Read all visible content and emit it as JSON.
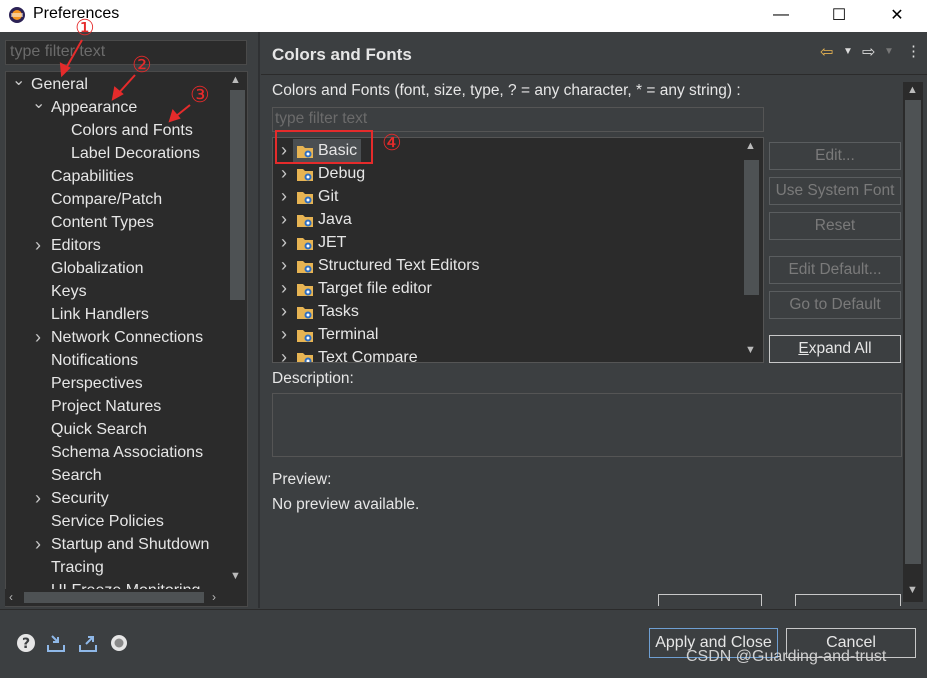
{
  "window": {
    "title": "Preferences",
    "controls": {
      "minimize": "—",
      "maximize": "☐",
      "close": "✕"
    }
  },
  "left": {
    "filter_placeholder": "type filter text",
    "tree": [
      {
        "label": "General",
        "level": 0,
        "expander": "down"
      },
      {
        "label": "Appearance",
        "level": 1,
        "expander": "down"
      },
      {
        "label": "Colors and Fonts",
        "level": 2,
        "expander": "none"
      },
      {
        "label": "Label Decorations",
        "level": 2,
        "expander": "none"
      },
      {
        "label": "Capabilities",
        "level": 1,
        "expander": "none"
      },
      {
        "label": "Compare/Patch",
        "level": 1,
        "expander": "none"
      },
      {
        "label": "Content Types",
        "level": 1,
        "expander": "none"
      },
      {
        "label": "Editors",
        "level": 1,
        "expander": "right"
      },
      {
        "label": "Globalization",
        "level": 1,
        "expander": "none"
      },
      {
        "label": "Keys",
        "level": 1,
        "expander": "none"
      },
      {
        "label": "Link Handlers",
        "level": 1,
        "expander": "none"
      },
      {
        "label": "Network Connections",
        "level": 1,
        "expander": "right"
      },
      {
        "label": "Notifications",
        "level": 1,
        "expander": "none"
      },
      {
        "label": "Perspectives",
        "level": 1,
        "expander": "none"
      },
      {
        "label": "Project Natures",
        "level": 1,
        "expander": "none"
      },
      {
        "label": "Quick Search",
        "level": 1,
        "expander": "none"
      },
      {
        "label": "Schema Associations",
        "level": 1,
        "expander": "none"
      },
      {
        "label": "Search",
        "level": 1,
        "expander": "none"
      },
      {
        "label": "Security",
        "level": 1,
        "expander": "right"
      },
      {
        "label": "Service Policies",
        "level": 1,
        "expander": "none"
      },
      {
        "label": "Startup and Shutdown",
        "level": 1,
        "expander": "right"
      },
      {
        "label": "Tracing",
        "level": 1,
        "expander": "none"
      },
      {
        "label": "UI Freeze Monitoring",
        "level": 1,
        "expander": "none"
      }
    ]
  },
  "right": {
    "title": "Colors and Fonts",
    "description": "Colors and Fonts (font, size, type, ? = any character, * = any string) :",
    "filter_placeholder": "type filter text",
    "font_tree": [
      {
        "label": "Basic",
        "selected": true
      },
      {
        "label": "Debug",
        "selected": false
      },
      {
        "label": "Git",
        "selected": false
      },
      {
        "label": "Java",
        "selected": false
      },
      {
        "label": "JET",
        "selected": false
      },
      {
        "label": "Structured Text Editors",
        "selected": false
      },
      {
        "label": "Target file editor",
        "selected": false
      },
      {
        "label": "Tasks",
        "selected": false
      },
      {
        "label": "Terminal",
        "selected": false
      },
      {
        "label": "Text Compare",
        "selected": false
      }
    ],
    "buttons": {
      "edit": "Edit...",
      "use_system_font": "Use System Font",
      "reset": "Reset",
      "edit_default": "Edit Default...",
      "go_to_default": "Go to Default",
      "expand_all_underline": "E",
      "expand_all_rest": "xpand All"
    },
    "description_label": "Description:",
    "preview_label": "Preview:",
    "preview_text": "No preview available."
  },
  "footer": {
    "apply_close": "Apply and Close",
    "cancel": "Cancel",
    "watermark": "CSDN @Guarding-and-trust"
  },
  "annotations": [
    "①",
    "②",
    "③",
    "④"
  ],
  "colors": {
    "accent_red": "#e52b2b",
    "folder": "#e7b453",
    "selection": "#4b4f52"
  }
}
